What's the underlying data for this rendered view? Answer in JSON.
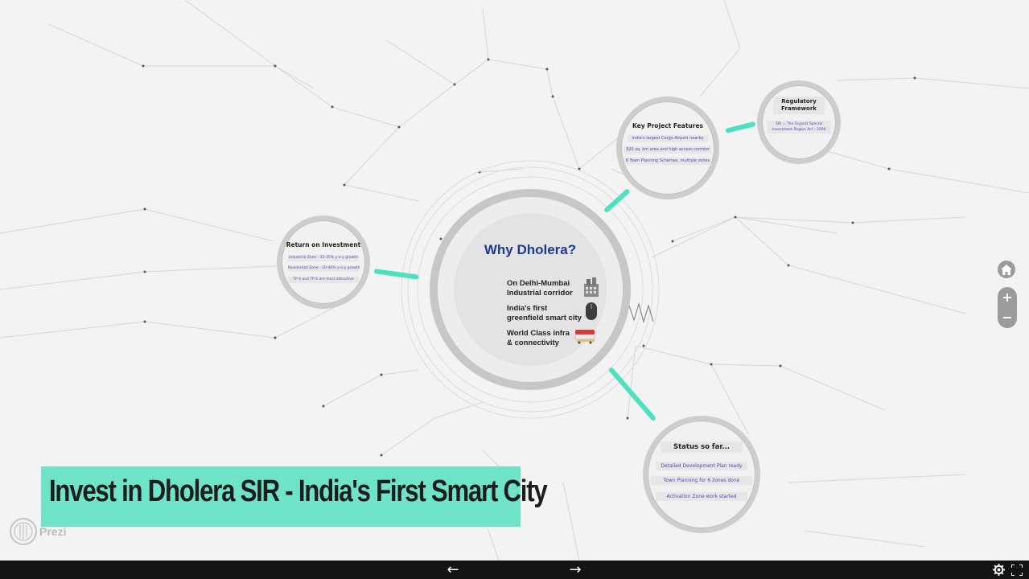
{
  "presentation": {
    "center": {
      "title": "Why Dholera?",
      "items": [
        {
          "line1": "On Delhi-Mumbai",
          "line2": "Industrial corridor",
          "icon": "factory-icon"
        },
        {
          "line1": "India's first",
          "line2": "greenfield smart city",
          "icon": "mouse-icon"
        },
        {
          "line1": "World Class infra",
          "line2": "& connectivity",
          "icon": "train-icon"
        }
      ]
    },
    "features": {
      "title": "Key Project Features",
      "items": [
        "India's largest Cargo Airport nearby",
        "920 sq. km area and high access corridor",
        "6 Town Planning Schemes, multiple zones"
      ]
    },
    "regulatory": {
      "title_line1": "Regulatory",
      "title_line2": "Framework",
      "item_line1": "SIR = The Gujarat Special",
      "item_line2": "Investment Region Act - 2009"
    },
    "roi": {
      "title": "Return on Investment",
      "items": [
        "Industrial Zone - 25-35% y-o-y growth",
        "Residential Zone - 20-40% y-o-y growth",
        "TP 4 and TP 6 are most attractive"
      ]
    },
    "status": {
      "title": "Status so far...",
      "items": [
        "Detailed Development Plan ready",
        "Town Planning for 6 zones done",
        "Activation Zone work started"
      ]
    }
  },
  "banner": {
    "text": "Invest in Dholera SIR - India's First Smart City"
  },
  "branding": {
    "logo_text": "Prezi"
  },
  "controls": {
    "home_icon": "home-icon",
    "zoom_in_label": "+",
    "zoom_out_label": "−",
    "prev_label": "←",
    "next_label": "→",
    "settings_icon": "gear-icon",
    "fullscreen_icon": "fullscreen-icon"
  },
  "colors": {
    "accent": "#4ee0bf",
    "banner_bg": "#6fe3c8",
    "title_blue": "#1d3b8c",
    "item_purple": "#5b3fb5",
    "bar_bg": "#141414"
  }
}
